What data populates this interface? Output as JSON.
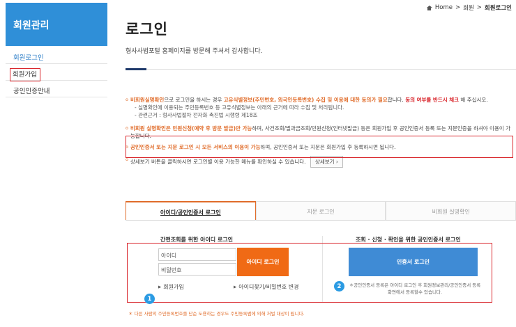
{
  "sidebar": {
    "header": "회원관리",
    "items": [
      {
        "label": "회원로그인"
      },
      {
        "label": "회원가입"
      },
      {
        "label": "공인인증안내"
      }
    ]
  },
  "breadcrumb": {
    "home": "Home",
    "sep": ">",
    "level1": "회원",
    "current": "회원로그인"
  },
  "page": {
    "title": "로그인",
    "subtitle": "형사사법포털 홈페이지를 방문해 주셔서 감사합니다."
  },
  "notice": {
    "p1_orange1": "비회원실명확인",
    "p1_text1": "으로 로그인을 하시는 경우 ",
    "p1_orange2": "고유식별정보(주민번호, 외국인등록번호) 수집 및 이용에 대한 동의가 필요",
    "p1_text2": "합니다. ",
    "p1_orange3": "동의 여부를 반드시 체크",
    "p1_text3": " 해 주십시오.",
    "sub1": "- 실명확인에 이용되는 주민등록번호 등 고유식별정보는 아래의 근거에 따라 수집 및 처리됩니다.",
    "sub2": "- 관련근거 : 형사사법절차 전자화 촉진법 시행령 제18조",
    "p2_orange": "비회원 실명확인은 민원신청(예약 후 방문 발급)만 가능",
    "p2_text": "하며, 사건조회/벌과금조회/민원신청(인터넷발급) 등은 회원가입 후 공인인증서 등록 또는 지문인증을 하셔야 이용이 가능합니다.",
    "p3_orange": "공인인증서 또는 지문 로그인 시 모든 서비스의 이용이 가능",
    "p3_text": "하며, 공인인증서 또는 지문은 회원가입 후 등록하시면 됩니다.",
    "p4_text": "상세보기 버튼을 클릭하시면 로그인별 이용 가능한 메뉴를 확인하실 수 있습니다.",
    "detail_button": "상세보기 ›"
  },
  "tabs": [
    {
      "label": "아이디/공인인증서 로그인"
    },
    {
      "label": "지문 로그인"
    },
    {
      "label": "비회원 실명확인"
    }
  ],
  "login": {
    "left_title": "간편조회를 위한 아이디 로그인",
    "right_title": "조회 · 신청 · 확인을 위한 공인인증서 로그인",
    "id_placeholder": "아이디",
    "pw_placeholder": "비밀번호",
    "id_login_button": "아이디 로그인",
    "cert_login_button": "인증서 로그인",
    "join_link": "회원가입",
    "find_link": "아이디찾기/비밀번호 변경",
    "cert_note": "＊공인인증서 등록은 아이디 로그인 후 회원정보관리/공인인증서 등록 화면에서 등록할수 있습니다.",
    "badge1": "1",
    "badge2": "2"
  },
  "footer": {
    "note": "＊ 다른 사람의 주민등록번호를 단순 도용하는 경우도 주민등록법에 의해 처벌 대상이 됩니다."
  },
  "colors": {
    "accent_blue": "#2f8fd8",
    "accent_orange": "#f06a15",
    "highlight_red": "#d9262c",
    "cert_blue": "#3f8bd5"
  }
}
